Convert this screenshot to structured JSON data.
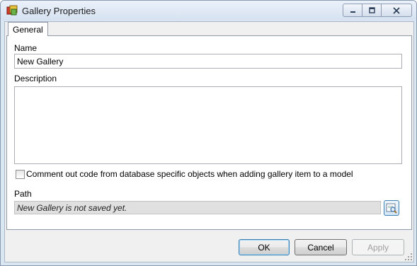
{
  "window": {
    "title": "Gallery Properties",
    "controls": {
      "minimize_icon": "minimize-icon",
      "maximize_icon": "maximize-icon",
      "close_icon": "close-icon"
    }
  },
  "tabs": [
    {
      "label": "General",
      "selected": true
    }
  ],
  "form": {
    "name_label": "Name",
    "name_value": "New Gallery",
    "description_label": "Description",
    "description_value": "",
    "comment_checkbox_label": "Comment out code from database specific objects when adding gallery item to a model",
    "comment_checkbox_checked": false,
    "path_label": "Path",
    "path_value": "New Gallery is not saved yet."
  },
  "buttons": {
    "ok": "OK",
    "cancel": "Cancel",
    "apply": "Apply"
  },
  "colors": {
    "accent": "#3c7fb1",
    "window_frame": "#dbe6f3",
    "path_background": "#e0e0e0"
  }
}
